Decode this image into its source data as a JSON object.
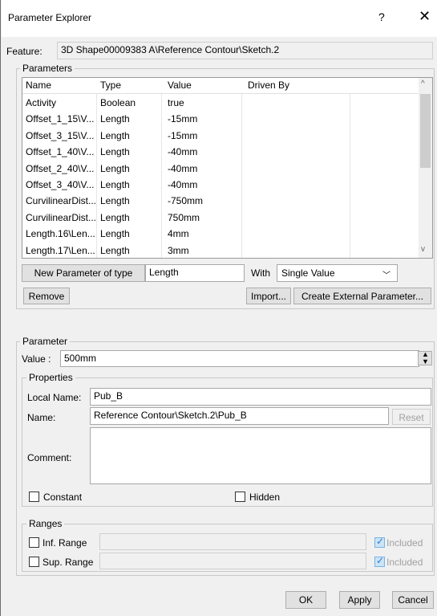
{
  "window": {
    "title": "Parameter Explorer",
    "help": "?",
    "close": "✕"
  },
  "feature": {
    "label": "Feature:",
    "value": "3D Shape00009383 A\\Reference Contour\\Sketch.2"
  },
  "parameters_group": {
    "label": "Parameters"
  },
  "table": {
    "headers": [
      "Name",
      "Type",
      "Value",
      "Driven By"
    ],
    "rows": [
      [
        "Activity",
        "Boolean",
        "true",
        ""
      ],
      [
        "Offset_1_15\\V...",
        "Length",
        "-15mm",
        ""
      ],
      [
        "Offset_3_15\\V...",
        "Length",
        "-15mm",
        ""
      ],
      [
        "Offset_1_40\\V...",
        "Length",
        "-40mm",
        ""
      ],
      [
        "Offset_2_40\\V...",
        "Length",
        "-40mm",
        ""
      ],
      [
        "Offset_3_40\\V...",
        "Length",
        "-40mm",
        ""
      ],
      [
        "CurvilinearDist...",
        "Length",
        "-750mm",
        ""
      ],
      [
        "CurvilinearDist...",
        "Length",
        "750mm",
        ""
      ],
      [
        "Length.16\\Len...",
        "Length",
        "4mm",
        ""
      ],
      [
        "Length.17\\Len...",
        "Length",
        "3mm",
        ""
      ]
    ]
  },
  "new_param": {
    "button": "New Parameter of type",
    "type_value": "Length",
    "with_label": "With",
    "with_value": "Single Value"
  },
  "buttons": {
    "remove": "Remove",
    "import": "Import...",
    "create_external": "Create External Parameter..."
  },
  "parameter_group": {
    "label": "Parameter",
    "value_label": "Value :",
    "value": "500mm"
  },
  "properties": {
    "label": "Properties",
    "local_name_label": "Local Name:",
    "local_name": "Pub_B",
    "name_label": "Name:",
    "name": "Reference Contour\\Sketch.2\\Pub_B",
    "reset": "Reset",
    "comment_label": "Comment:",
    "comment": "",
    "constant": "Constant",
    "hidden": "Hidden"
  },
  "ranges": {
    "label": "Ranges",
    "inf": "Inf. Range",
    "sup": "Sup. Range",
    "included1": "Included",
    "included2": "Included"
  },
  "footer": {
    "ok": "OK",
    "apply": "Apply",
    "cancel": "Cancel"
  }
}
